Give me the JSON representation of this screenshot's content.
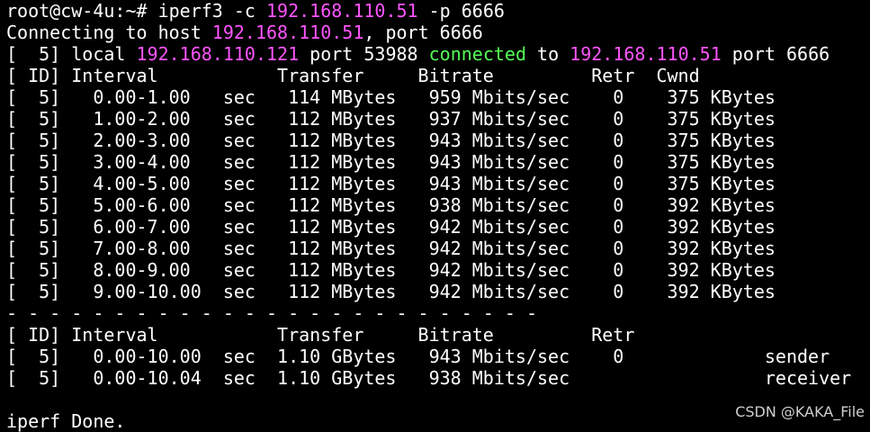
{
  "terminal": {
    "prompt": "root@cw-4u:~# ",
    "command_prefix": "iperf3 -c ",
    "command_host": "192.168.110.51",
    "command_suffix": " -p 6666",
    "connecting_prefix": "Connecting to host ",
    "connecting_host": "192.168.110.51",
    "connecting_suffix": ", port 6666",
    "local_prefix": "[  5] local ",
    "local_ip": "192.168.110.121",
    "local_port": " port 53988 ",
    "connected_word": "connected",
    "to_word": " to ",
    "remote_ip": "192.168.110.51",
    "remote_port": " port 6666",
    "header": "[ ID] Interval           Transfer     Bitrate         Retr  Cwnd",
    "rows": [
      "[  5]   0.00-1.00   sec   114 MBytes   959 Mbits/sec    0    375 KBytes",
      "[  5]   1.00-2.00   sec   112 MBytes   937 Mbits/sec    0    375 KBytes",
      "[  5]   2.00-3.00   sec   112 MBytes   943 Mbits/sec    0    375 KBytes",
      "[  5]   3.00-4.00   sec   112 MBytes   943 Mbits/sec    0    375 KBytes",
      "[  5]   4.00-5.00   sec   112 MBytes   943 Mbits/sec    0    375 KBytes",
      "[  5]   5.00-6.00   sec   112 MBytes   938 Mbits/sec    0    392 KBytes",
      "[  5]   6.00-7.00   sec   112 MBytes   942 Mbits/sec    0    392 KBytes",
      "[  5]   7.00-8.00   sec   112 MBytes   942 Mbits/sec    0    392 KBytes",
      "[  5]   8.00-9.00   sec   112 MBytes   942 Mbits/sec    0    392 KBytes",
      "[  5]   9.00-10.00  sec   112 MBytes   942 Mbits/sec    0    392 KBytes"
    ],
    "separator": "- - - - - - - - - - - - - - - - - - - - - - - - -",
    "summary_header": "[ ID] Interval           Transfer     Bitrate         Retr",
    "summary_rows": [
      "[  5]   0.00-10.00  sec  1.10 GBytes   943 Mbits/sec    0             sender",
      "[  5]   0.00-10.04  sec  1.10 GBytes   938 Mbits/sec                  receiver"
    ],
    "blank": "",
    "done": "iperf Done."
  },
  "watermark": "CSDN @KAKA_File",
  "colors": {
    "background": "#000000",
    "text": "#ffffff",
    "ip_highlight": "#ff55ff",
    "connected_highlight": "#55ff55"
  }
}
